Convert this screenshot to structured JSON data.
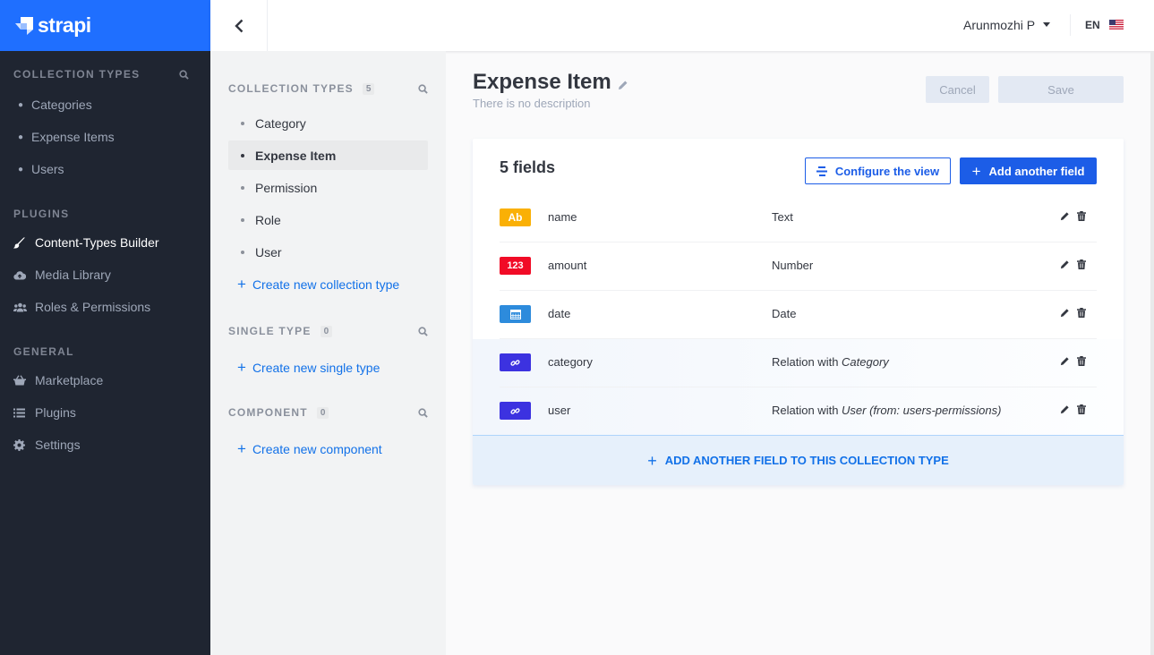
{
  "brand": {
    "name": "strapi",
    "color": "#1f6fff"
  },
  "left_nav": {
    "collection_types": {
      "heading": "COLLECTION TYPES",
      "items": [
        {
          "label": "Categories"
        },
        {
          "label": "Expense Items"
        },
        {
          "label": "Users"
        }
      ]
    },
    "plugins": {
      "heading": "PLUGINS",
      "items": [
        {
          "label": "Content-Types Builder",
          "icon": "paintbrush-icon",
          "active": true
        },
        {
          "label": "Media Library",
          "icon": "cloud-upload-icon"
        },
        {
          "label": "Roles & Permissions",
          "icon": "users-icon"
        }
      ]
    },
    "general": {
      "heading": "GENERAL",
      "items": [
        {
          "label": "Marketplace",
          "icon": "basket-icon"
        },
        {
          "label": "Plugins",
          "icon": "list-icon"
        },
        {
          "label": "Settings",
          "icon": "gear-icon"
        }
      ]
    }
  },
  "header": {
    "user_name": "Arunmozhi P",
    "language": "EN",
    "language_flag": "us-flag-icon"
  },
  "ctb_menu": {
    "collection_types": {
      "heading": "COLLECTION TYPES",
      "count": "5",
      "items": [
        {
          "label": "Category"
        },
        {
          "label": "Expense Item",
          "active": true
        },
        {
          "label": "Permission"
        },
        {
          "label": "Role"
        },
        {
          "label": "User"
        }
      ],
      "create_label": "Create new collection type"
    },
    "single_types": {
      "heading": "SINGLE TYPE",
      "count": "0",
      "create_label": "Create new single type"
    },
    "components": {
      "heading": "COMPONENT",
      "count": "0",
      "create_label": "Create new component"
    }
  },
  "content_type": {
    "title": "Expense Item",
    "description": "There is no description",
    "cancel_label": "Cancel",
    "save_label": "Save",
    "fields_count_label": "5 fields",
    "configure_view_label": "Configure the view",
    "add_field_label": "Add another field",
    "footer_add_label": "ADD ANOTHER FIELD TO THIS COLLECTION TYPE",
    "fields": [
      {
        "name": "name",
        "type_label": "Text",
        "type_target": "",
        "icon_text": "Ab",
        "icon": "text-type-icon",
        "color": "#fab005"
      },
      {
        "name": "amount",
        "type_label": "Number",
        "type_target": "",
        "icon_text": "123",
        "icon": "number-type-icon",
        "color": "#f10b26"
      },
      {
        "name": "date",
        "type_label": "Date",
        "type_target": "",
        "icon_text": "",
        "icon": "calendar-type-icon",
        "color": "#2d8bdc"
      },
      {
        "name": "category",
        "type_label": "Relation with ",
        "type_target": "Category",
        "icon_text": "",
        "icon": "relation-type-icon",
        "color": "#3c32e0"
      },
      {
        "name": "user",
        "type_label": "Relation with ",
        "type_target": "User (from: users-permissions)",
        "icon_text": "",
        "icon": "relation-type-icon",
        "color": "#3c32e0"
      }
    ]
  }
}
